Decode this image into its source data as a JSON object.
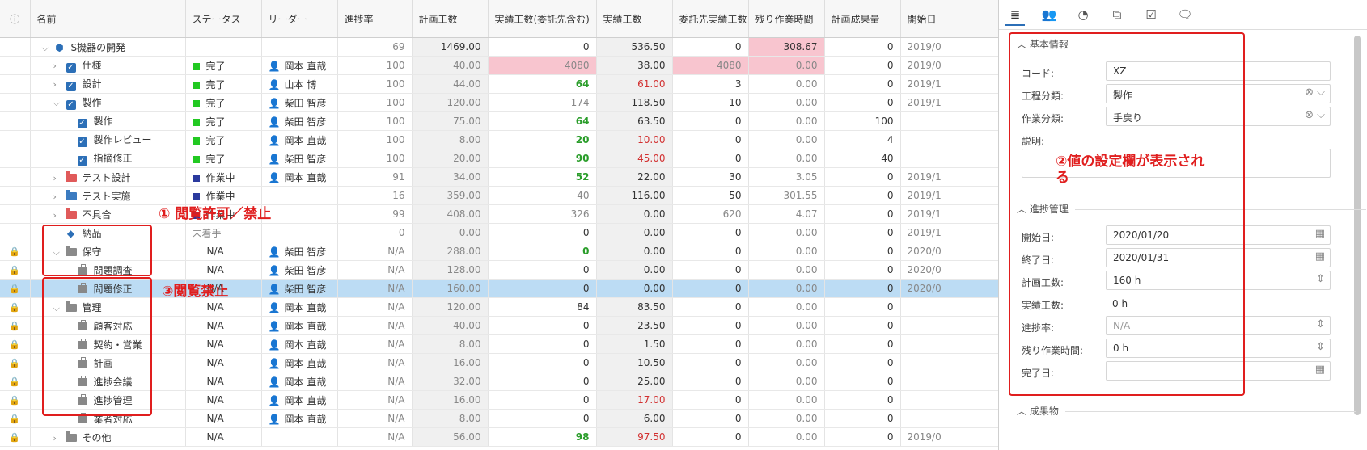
{
  "columns": [
    "",
    "名前",
    "ステータス",
    "リーダー",
    "進捗率",
    "計画工数",
    "実績工数(委託先含む)",
    "実績工数",
    "委託先実績工数",
    "残り作業時間",
    "計画成果量",
    "開始日"
  ],
  "rows": [
    {
      "lock": "",
      "chev": "⌵",
      "indent": 1,
      "icon": "cube",
      "name": "S機器の開発",
      "status": "",
      "sc": "",
      "leader": "",
      "prog": "69",
      "plan": "1469.00",
      "actAll": "0",
      "act": "536.50",
      "sub": "0",
      "rem": "308.67",
      "out": "0",
      "start": "2019/0"
    },
    {
      "lock": "",
      "chev": "›",
      "indent": 2,
      "icon": "check",
      "name": "仕様",
      "status": "完了",
      "sc": "#22c922",
      "leader": "岡本 直哉",
      "prog": "100",
      "plan": "40.00",
      "actAll": "4080",
      "act": "38.00",
      "sub": "4080",
      "rem": "0.00",
      "out": "0",
      "start": "2019/0"
    },
    {
      "lock": "",
      "chev": "›",
      "indent": 2,
      "icon": "check",
      "name": "設計",
      "status": "完了",
      "sc": "#22c922",
      "leader": "山本 博",
      "prog": "100",
      "plan": "44.00",
      "actAll": "64",
      "act": "61.00",
      "sub": "3",
      "rem": "0.00",
      "out": "0",
      "start": "2019/1"
    },
    {
      "lock": "",
      "chev": "⌵",
      "indent": 2,
      "icon": "check",
      "name": "製作",
      "status": "完了",
      "sc": "#22c922",
      "leader": "柴田 智彦",
      "prog": "100",
      "plan": "120.00",
      "actAll": "174",
      "act": "118.50",
      "sub": "10",
      "rem": "0.00",
      "out": "0",
      "start": "2019/1"
    },
    {
      "lock": "",
      "chev": "",
      "indent": 3,
      "icon": "check",
      "name": "製作",
      "status": "完了",
      "sc": "#22c922",
      "leader": "柴田 智彦",
      "prog": "100",
      "plan": "75.00",
      "actAll": "64",
      "act": "63.50",
      "sub": "0",
      "rem": "0.00",
      "out": "100",
      "start": ""
    },
    {
      "lock": "",
      "chev": "",
      "indent": 3,
      "icon": "check",
      "name": "製作レビュー",
      "status": "完了",
      "sc": "#22c922",
      "leader": "岡本 直哉",
      "prog": "100",
      "plan": "8.00",
      "actAll": "20",
      "act": "10.00",
      "sub": "0",
      "rem": "0.00",
      "out": "4",
      "start": ""
    },
    {
      "lock": "",
      "chev": "",
      "indent": 3,
      "icon": "check",
      "name": "指摘修正",
      "status": "完了",
      "sc": "#22c922",
      "leader": "柴田 智彦",
      "prog": "100",
      "plan": "20.00",
      "actAll": "90",
      "act": "45.00",
      "sub": "0",
      "rem": "0.00",
      "out": "40",
      "start": ""
    },
    {
      "lock": "",
      "chev": "›",
      "indent": 2,
      "icon": "folder-red",
      "name": "テスト設計",
      "status": "作業中",
      "sc": "#2b3a9e",
      "leader": "岡本 直哉",
      "prog": "91",
      "plan": "34.00",
      "actAll": "52",
      "act": "22.00",
      "sub": "30",
      "rem": "3.05",
      "out": "0",
      "start": "2019/1"
    },
    {
      "lock": "",
      "chev": "›",
      "indent": 2,
      "icon": "folder-blue",
      "name": "テスト実施",
      "status": "作業中",
      "sc": "#2b3a9e",
      "leader": "",
      "prog": "16",
      "plan": "359.00",
      "actAll": "40",
      "act": "116.00",
      "sub": "50",
      "rem": "301.55",
      "out": "0",
      "start": "2019/1"
    },
    {
      "lock": "",
      "chev": "›",
      "indent": 2,
      "icon": "folder-red",
      "name": "不具合",
      "status": "作業中",
      "sc": "#2b3a9e",
      "leader": "",
      "prog": "99",
      "plan": "408.00",
      "actAll": "326",
      "act": "0.00",
      "sub": "620",
      "rem": "4.07",
      "out": "0",
      "start": "2019/1"
    },
    {
      "lock": "",
      "chev": "",
      "indent": 2,
      "icon": "diamond",
      "name": "納品",
      "status": "未着手",
      "sc": "",
      "leader": "",
      "prog": "0",
      "plan": "0.00",
      "actAll": "0",
      "act": "0.00",
      "sub": "0",
      "rem": "0.00",
      "out": "0",
      "start": "2019/1"
    },
    {
      "lock": "dark",
      "chev": "⌵",
      "indent": 2,
      "icon": "folder-grey",
      "name": "保守",
      "status": "N/A",
      "sc": "",
      "leader": "柴田 智彦",
      "prog": "N/A",
      "plan": "288.00",
      "actAll": "0",
      "act": "0.00",
      "sub": "0",
      "rem": "0.00",
      "out": "0",
      "start": "2020/0"
    },
    {
      "lock": "light",
      "chev": "",
      "indent": 3,
      "icon": "brief",
      "name": "問題調査",
      "status": "N/A",
      "sc": "",
      "leader": "柴田 智彦",
      "prog": "N/A",
      "plan": "128.00",
      "actAll": "0",
      "act": "0.00",
      "sub": "0",
      "rem": "0.00",
      "out": "0",
      "start": "2020/0"
    },
    {
      "lock": "light",
      "chev": "",
      "indent": 3,
      "icon": "brief",
      "name": "問題修正",
      "status": "N/A",
      "sc": "",
      "leader": "柴田 智彦",
      "prog": "N/A",
      "plan": "160.00",
      "actAll": "0",
      "act": "0.00",
      "sub": "0",
      "rem": "0.00",
      "out": "0",
      "start": "2020/0",
      "selected": true
    },
    {
      "lock": "dark",
      "chev": "⌵",
      "indent": 2,
      "icon": "folder-grey",
      "name": "管理",
      "status": "N/A",
      "sc": "",
      "leader": "岡本 直哉",
      "prog": "N/A",
      "plan": "120.00",
      "actAll": "84",
      "act": "83.50",
      "sub": "0",
      "rem": "0.00",
      "out": "0",
      "start": ""
    },
    {
      "lock": "light",
      "chev": "",
      "indent": 3,
      "icon": "brief",
      "name": "顧客対応",
      "status": "N/A",
      "sc": "",
      "leader": "岡本 直哉",
      "prog": "N/A",
      "plan": "40.00",
      "actAll": "0",
      "act": "23.50",
      "sub": "0",
      "rem": "0.00",
      "out": "0",
      "start": ""
    },
    {
      "lock": "light",
      "chev": "",
      "indent": 3,
      "icon": "brief",
      "name": "契約・営業",
      "status": "N/A",
      "sc": "",
      "leader": "岡本 直哉",
      "prog": "N/A",
      "plan": "8.00",
      "actAll": "0",
      "act": "1.50",
      "sub": "0",
      "rem": "0.00",
      "out": "0",
      "start": ""
    },
    {
      "lock": "light",
      "chev": "",
      "indent": 3,
      "icon": "brief",
      "name": "計画",
      "status": "N/A",
      "sc": "",
      "leader": "岡本 直哉",
      "prog": "N/A",
      "plan": "16.00",
      "actAll": "0",
      "act": "10.50",
      "sub": "0",
      "rem": "0.00",
      "out": "0",
      "start": ""
    },
    {
      "lock": "light",
      "chev": "",
      "indent": 3,
      "icon": "brief",
      "name": "進捗会議",
      "status": "N/A",
      "sc": "",
      "leader": "岡本 直哉",
      "prog": "N/A",
      "plan": "32.00",
      "actAll": "0",
      "act": "25.00",
      "sub": "0",
      "rem": "0.00",
      "out": "0",
      "start": ""
    },
    {
      "lock": "light",
      "chev": "",
      "indent": 3,
      "icon": "brief",
      "name": "進捗管理",
      "status": "N/A",
      "sc": "",
      "leader": "岡本 直哉",
      "prog": "N/A",
      "plan": "16.00",
      "actAll": "0",
      "act": "17.00",
      "sub": "0",
      "rem": "0.00",
      "out": "0",
      "start": ""
    },
    {
      "lock": "light",
      "chev": "",
      "indent": 3,
      "icon": "brief",
      "name": "業者対応",
      "status": "N/A",
      "sc": "",
      "leader": "岡本 直哉",
      "prog": "N/A",
      "plan": "8.00",
      "actAll": "0",
      "act": "6.00",
      "sub": "0",
      "rem": "0.00",
      "out": "0",
      "start": ""
    },
    {
      "lock": "dark",
      "chev": "›",
      "indent": 2,
      "icon": "folder-grey",
      "name": "その他",
      "status": "N/A",
      "sc": "",
      "leader": "",
      "prog": "N/A",
      "plan": "56.00",
      "actAll": "98",
      "act": "97.50",
      "sub": "0",
      "rem": "0.00",
      "out": "0",
      "start": "2019/0"
    }
  ],
  "annotations": {
    "a1": "① 閲覧許可／禁止",
    "a2": "②値の設定欄が表示される",
    "a3": "③閲覧禁止"
  },
  "panel": {
    "sec_basic": "基本情報",
    "code_label": "コード:",
    "code_value": "XZ",
    "process_label": "工程分類:",
    "process_value": "製作",
    "work_label": "作業分類:",
    "work_value": "手戻り",
    "desc_label": "説明:",
    "sec_progress": "進捗管理",
    "start_label": "開始日:",
    "start_value": "2020/01/20",
    "end_label": "終了日:",
    "end_value": "2020/01/31",
    "plan_label": "計画工数:",
    "plan_value": "160 h",
    "actual_label": "実績工数:",
    "actual_value": "0 h",
    "rate_label": "進捗率:",
    "rate_value": "N/A",
    "remain_label": "残り作業時間:",
    "remain_value": "0 h",
    "done_label": "完了日:",
    "done_value": "",
    "sec_output": "成果物"
  }
}
